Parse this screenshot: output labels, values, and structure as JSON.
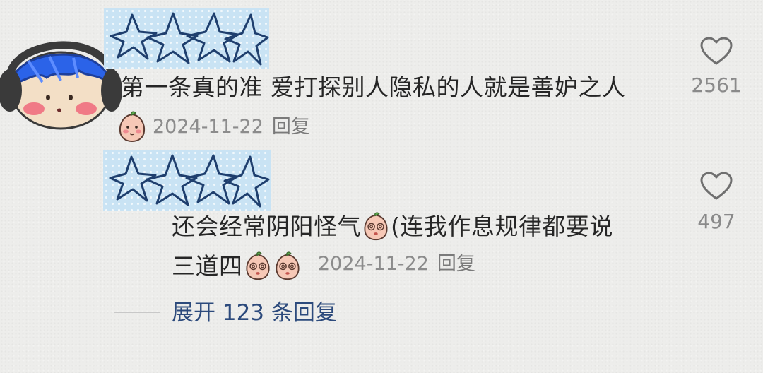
{
  "comments": [
    {
      "text": "第一条真的准 爱打探别人隐私的人就是善妒之人",
      "date": "2024-11-22",
      "reply_label": "回复",
      "like_count": "2561",
      "badge_icon": "peach-face-icon"
    },
    {
      "text_line1_a": "还会经常阴阳怪气",
      "text_line1_b": "(连我作息规律都要说",
      "text_line2": "三道四",
      "date": "2024-11-22",
      "reply_label": "回复",
      "like_count": "497",
      "emoji_icons": [
        "peach-dizzy-face-icon",
        "peach-dizzy-face-icon",
        "peach-dizzy-face-icon"
      ]
    }
  ],
  "expand": {
    "label": "展开 123 条回复"
  },
  "colors": {
    "background": "#ededeb",
    "mask_fill": "#c9e3f4",
    "mask_stars": "#1f3f6e",
    "link_blue": "#2c4a7c",
    "meta_gray": "#8c8c8c"
  }
}
